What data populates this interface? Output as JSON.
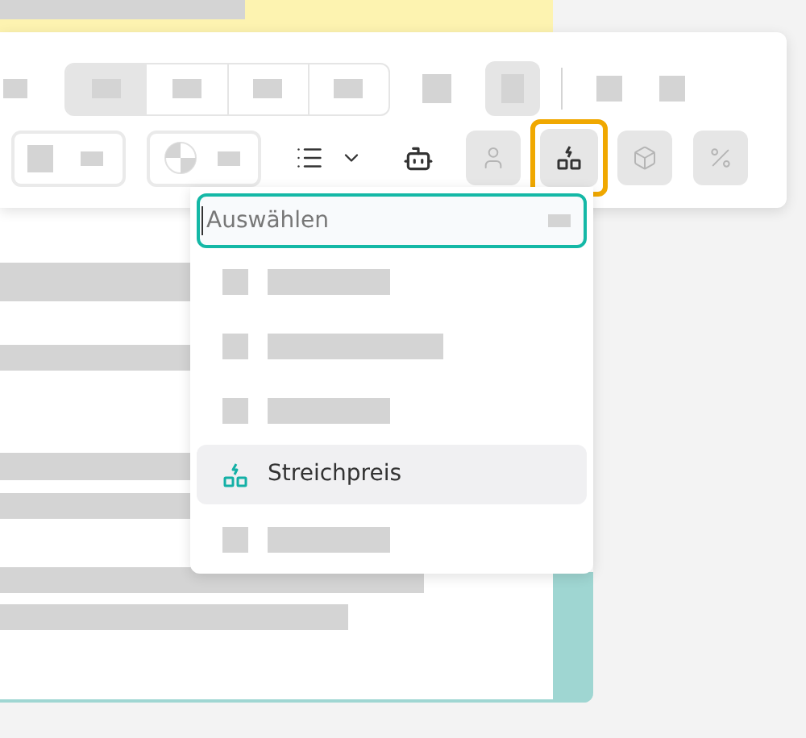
{
  "toolbar": {
    "segments": [
      {
        "selected": true
      },
      {
        "selected": false
      },
      {
        "selected": false
      },
      {
        "selected": false
      }
    ],
    "action_buttons": [
      {
        "kind": "person",
        "highlighted": false
      },
      {
        "kind": "shapes",
        "highlighted": true
      },
      {
        "kind": "cube",
        "highlighted": false
      },
      {
        "kind": "percent",
        "highlighted": false
      }
    ]
  },
  "dropdown": {
    "placeholder": "Auswählen",
    "options": [
      {
        "kind": "redacted",
        "selected": false
      },
      {
        "kind": "redacted",
        "selected": false
      },
      {
        "kind": "redacted",
        "selected": false
      },
      {
        "kind": "item",
        "label": "Streichpreis",
        "selected": true
      },
      {
        "kind": "redacted",
        "selected": false
      }
    ]
  }
}
